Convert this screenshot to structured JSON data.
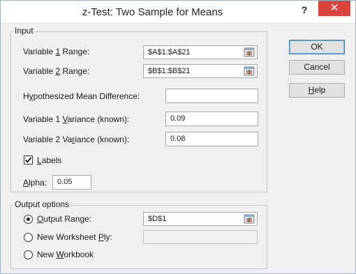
{
  "window": {
    "title": "z-Test: Two Sample for Means",
    "help_glyph": "?",
    "close_glyph": "✕"
  },
  "input": {
    "group_label": "Input",
    "var1_range": {
      "pre": "Variable ",
      "u": "1",
      "post": " Range:",
      "value": "$A$1:$A$21"
    },
    "var2_range": {
      "pre": "Variable ",
      "u": "2",
      "post": " Range:",
      "value": "$B$1:$B$21"
    },
    "hyp_diff": {
      "pre": "H",
      "u": "y",
      "post": "pothesized Mean Difference:",
      "value": ""
    },
    "var1_variance": {
      "pre": "Variable 1 ",
      "u": "V",
      "post": "ariance (known):",
      "value": "0.09"
    },
    "var2_variance": {
      "pre": "Variable 2 Va",
      "u": "r",
      "post": "iance (known):",
      "value": "0.08"
    },
    "labels": {
      "u": "L",
      "post": "abels",
      "checked": true
    },
    "alpha": {
      "u": "A",
      "post": "lpha:",
      "value": "0.05"
    }
  },
  "output": {
    "group_label": "Output options",
    "output_range": {
      "u": "O",
      "post": "utput Range:",
      "value": "$D$1",
      "selected": true
    },
    "new_ply": {
      "pre": "New Worksheet ",
      "u": "P",
      "post": "ly:",
      "value": ""
    },
    "new_workbook": {
      "pre": "New ",
      "u": "W",
      "post": "orkbook"
    }
  },
  "buttons": {
    "ok": "OK",
    "cancel": "Cancel",
    "help_u": "H",
    "help_post": "elp"
  },
  "icons": {
    "ref": "range-selector-icon"
  }
}
